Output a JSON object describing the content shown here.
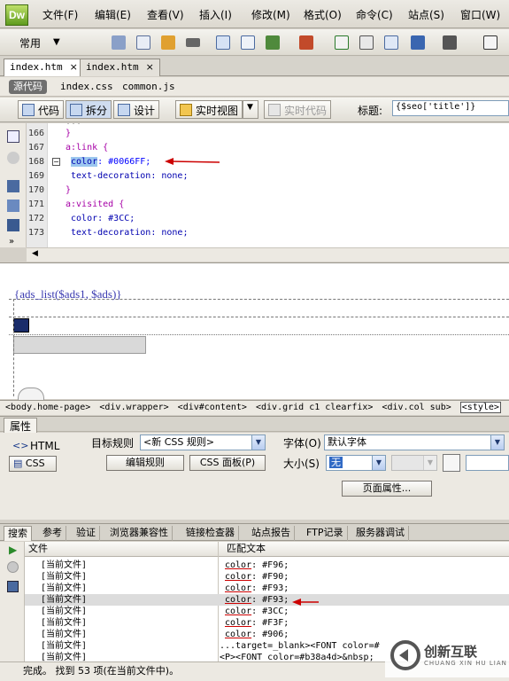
{
  "app": {
    "logo": "Dw"
  },
  "menu": [
    "文件(F)",
    "编辑(E)",
    "查看(V)",
    "插入(I)",
    "修改(M)",
    "格式(O)",
    "命令(C)",
    "站点(S)",
    "窗口(W)"
  ],
  "toolbar": {
    "workspace_label": "常用"
  },
  "doc_tabs": [
    {
      "label": "index.htm",
      "close": "×"
    },
    {
      "label": "index.htm",
      "close": "×"
    }
  ],
  "related_files": {
    "source_label": "源代码",
    "files": [
      "index.css",
      "common.js"
    ]
  },
  "doc_toolbar": {
    "code_label": "代码",
    "split_label": "拆分",
    "design_label": "设计",
    "live_view_label": "实时视图",
    "live_code_label": "实时代码",
    "title_label": "标题:",
    "title_value": "{$seo['title']}"
  },
  "code": {
    "line_numbers": [
      "166",
      "167",
      "168",
      "169",
      "170",
      "171",
      "172",
      "173"
    ],
    "top_fragment": "...",
    "lines": [
      {
        "text": "}"
      },
      {
        "text": "a:link {"
      },
      {
        "prop": "color",
        "rest": ": #0066FF;"
      },
      {
        "text": " text-decoration: none;"
      },
      {
        "text": "}"
      },
      {
        "text": "a:visited {"
      },
      {
        "text": " color: #3CC;"
      },
      {
        "text": " text-decoration: none;"
      }
    ]
  },
  "design": {
    "ads_text": "{ads_list($ads1, $ads)}"
  },
  "tag_selector": [
    "<body.home-page>",
    "<div.wrapper>",
    "<div#content>",
    "<div.grid c1 clearfix>",
    "<div.col sub>",
    "<style>"
  ],
  "properties": {
    "header": "属性",
    "html_label": "HTML",
    "css_label": "CSS",
    "target_rule_label": "目标规则",
    "target_rule_value": "<新 CSS 规则>",
    "edit_rule_button": "编辑规则",
    "css_panel_button": "CSS 面板(P)",
    "font_label": "字体(O)",
    "font_value": "默认字体",
    "size_label": "大小(S)",
    "size_value": "无",
    "page_props_button": "页面属性..."
  },
  "results": {
    "tabs": [
      "搜索",
      "参考",
      "验证",
      "浏览器兼容性",
      "链接检查器",
      "站点报告",
      "FTP记录",
      "服务器调试"
    ],
    "col_file": "文件",
    "col_match": "匹配文本",
    "rows": [
      {
        "file": "[当前文件]",
        "match_key": "color",
        "match_rest": ": #F96;"
      },
      {
        "file": "[当前文件]",
        "match_key": "color",
        "match_rest": ": #F90;"
      },
      {
        "file": "[当前文件]",
        "match_key": "color",
        "match_rest": ": #F93;"
      },
      {
        "file": "[当前文件]",
        "match_key": "color",
        "match_rest": ": #F93;"
      },
      {
        "file": "[当前文件]",
        "match_key": "color",
        "match_rest": ": #3CC;"
      },
      {
        "file": "[当前文件]",
        "match_key": "color",
        "match_rest": ": #F3F;"
      },
      {
        "file": "[当前文件]",
        "match_key": "color",
        "match_rest": ": #906;"
      },
      {
        "file": "[当前文件]",
        "match_key": "",
        "match_rest": "...target=_blank><FONT color=#"
      },
      {
        "file": "[当前文件]",
        "match_key": "",
        "match_rest": "<P><FONT color=#b38a4d>&nbsp;"
      }
    ],
    "status": "完成。 找到 53 项(在当前文件中)。"
  },
  "watermark": {
    "text": "创新互联",
    "sub": "CHUANG XIN HU LIAN"
  },
  "colors": {
    "accent_arrow": "#cc0000",
    "link": "#0066FF"
  }
}
